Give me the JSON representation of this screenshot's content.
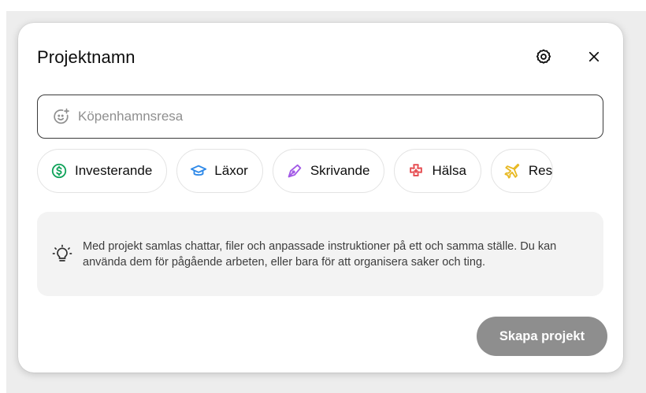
{
  "dialog": {
    "title": "Projektnamn",
    "settings_icon": "gear-icon",
    "close_icon": "close-icon"
  },
  "name_field": {
    "placeholder": "Köpenhamnsresa",
    "value": "",
    "icon": "add-emoji-icon"
  },
  "categories": [
    {
      "label": "Investerande",
      "icon": "dollar-circle-icon",
      "color": "#11a35b"
    },
    {
      "label": "Läxor",
      "icon": "graduation-cap-icon",
      "color": "#2d88e8"
    },
    {
      "label": "Skrivande",
      "icon": "pen-nib-icon",
      "color": "#a259e6"
    },
    {
      "label": "Hälsa",
      "icon": "medical-cross-icon",
      "color": "#e5484d"
    },
    {
      "label": "Res",
      "icon": "airplane-icon",
      "color": "#e8b923"
    }
  ],
  "info": {
    "icon": "lightbulb-icon",
    "text": "Med projekt samlas chattar, filer och anpassade instruktioner på ett och samma ställe. Du kan använda dem för pågående arbeten, eller bara för att organisera saker och ting."
  },
  "actions": {
    "create_label": "Skapa projekt",
    "create_color": "#8e8e8e"
  }
}
